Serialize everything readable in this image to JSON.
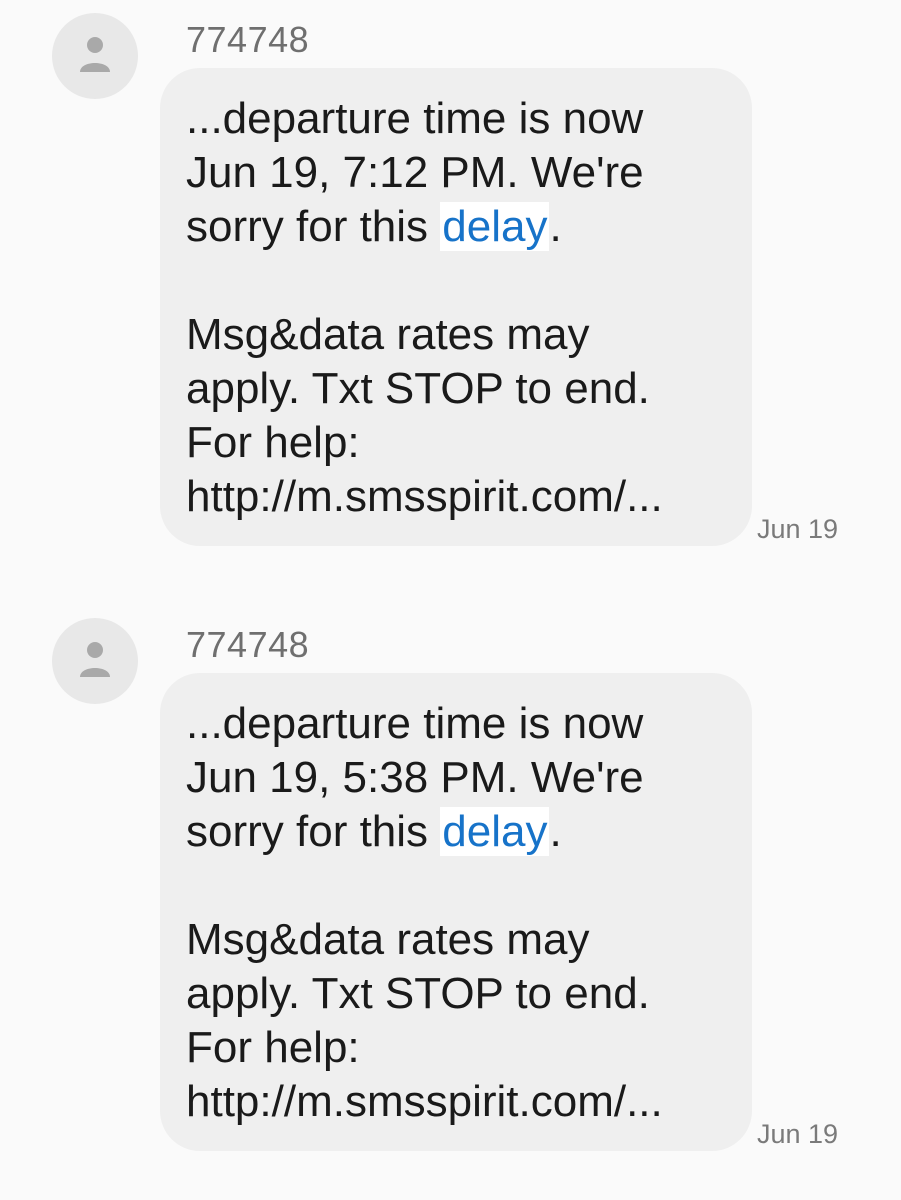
{
  "messages": [
    {
      "sender": "774748",
      "lines_a": [
        "...departure time is now",
        "Jun 19, 7:12 PM. We're"
      ],
      "line_pre": "sorry for this ",
      "link_text": "delay",
      "line_post": ".",
      "lines_b": [
        "Msg&data rates may",
        "apply. Txt STOP to end.",
        "For help:",
        "http://m.smsspirit.com/..."
      ],
      "time": "Jun 19"
    },
    {
      "sender": "774748",
      "lines_a": [
        "...departure time is now",
        "Jun 19, 5:38 PM. We're"
      ],
      "line_pre": "sorry for this ",
      "link_text": "delay",
      "line_post": ".",
      "lines_b": [
        "Msg&data rates may",
        "apply. Txt STOP to end.",
        "For help:",
        "http://m.smsspirit.com/..."
      ],
      "time": "Jun 19"
    }
  ],
  "colors": {
    "background": "#fafafa",
    "bubble": "#efefef",
    "link": "#1773c9",
    "avatar": "#e8e8e8"
  },
  "icons": {
    "avatar": "person-icon"
  }
}
